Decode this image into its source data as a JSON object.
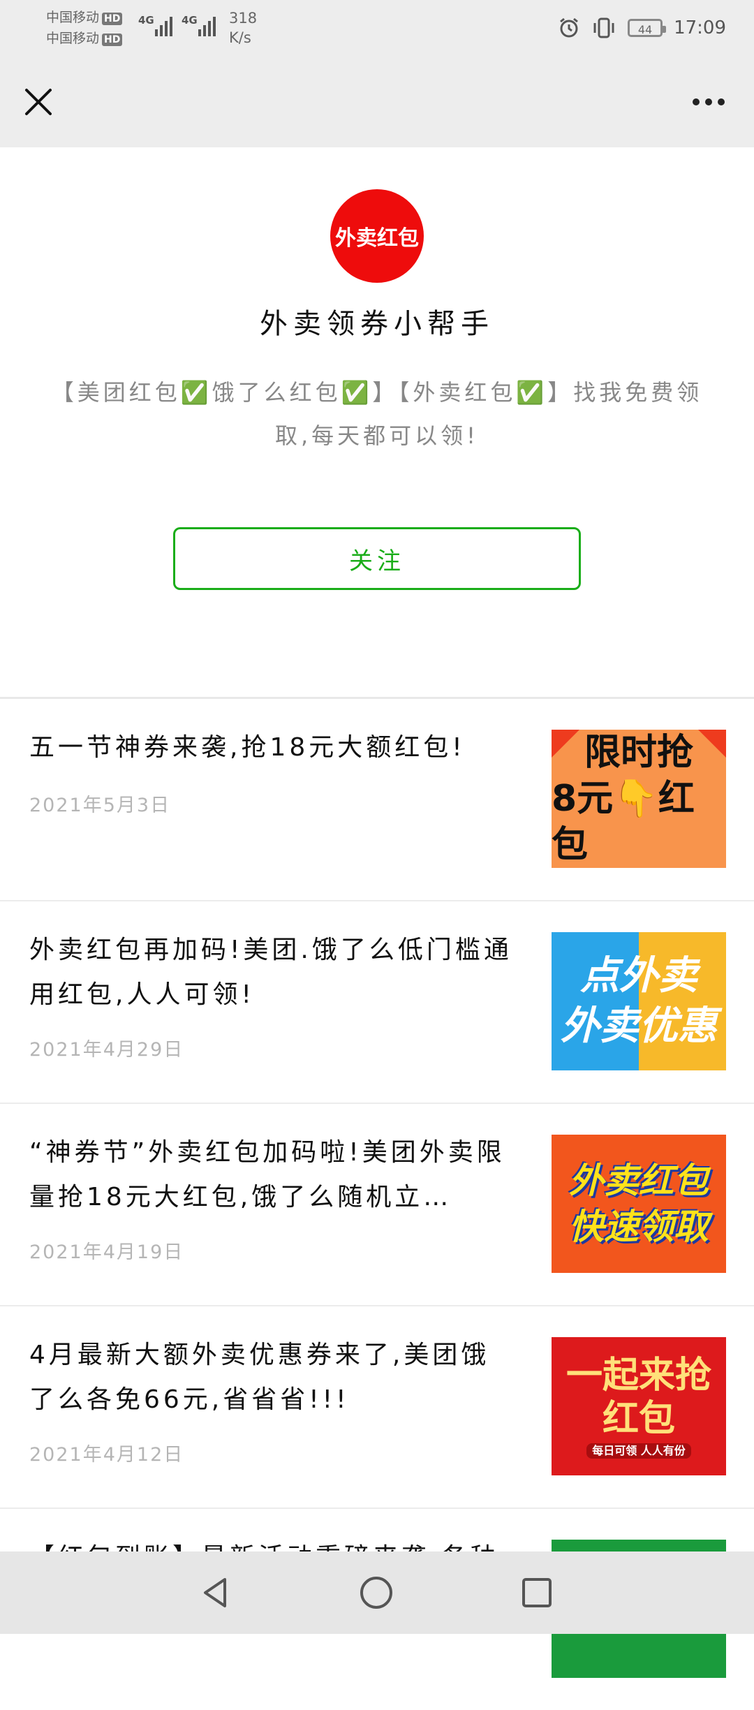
{
  "status_bar": {
    "carrier_1": "中国移动",
    "carrier_2": "中国移动",
    "hd_badge": "HD",
    "network_type": "4G",
    "speed_value": "318",
    "speed_unit": "K/s",
    "battery": "44",
    "time": "17:09",
    "icons": [
      "alarm-icon",
      "vibrate-icon",
      "battery-icon"
    ]
  },
  "nav": {
    "close_icon": "close-icon",
    "more_icon": "more-icon"
  },
  "profile": {
    "avatar_text": "外卖红包",
    "avatar_color": "#ee0c0c",
    "name": "外卖领券小帮手",
    "description": "【美团红包✅饿了么红包✅】【外卖红包✅】找我免费领取,每天都可以领!",
    "follow_label": "关注",
    "follow_color": "#1aad19"
  },
  "articles": [
    {
      "title": "五一节神券来袭,抢18元大额红包!",
      "date": "2021年5月3日",
      "thumb_text": [
        "限时抢",
        "8元👇红包"
      ]
    },
    {
      "title": "外卖红包再加码!美团.饿了么低门槛通用红包,人人可领!",
      "date": "2021年4月29日",
      "thumb_text": [
        "点外卖",
        "外卖优惠"
      ]
    },
    {
      "title": "“神券节”外卖红包加码啦!美团外卖限量抢18元大红包,饿了么随机立…",
      "date": "2021年4月19日",
      "thumb_text": [
        "外卖红包",
        "快速领取"
      ]
    },
    {
      "title": "4月最新大额外卖优惠券来了,美团饿了么各免66元,省省省!!!",
      "date": "2021年4月12日",
      "thumb_text": [
        "一起来抢",
        "红包",
        "每日可领  人人有份"
      ]
    },
    {
      "title": "【红包到账】最新活动重磅来袭,各种",
      "date": ""
    }
  ],
  "system_nav": {
    "back_icon": "back-icon",
    "home_icon": "home-icon",
    "recents_icon": "recents-icon"
  }
}
